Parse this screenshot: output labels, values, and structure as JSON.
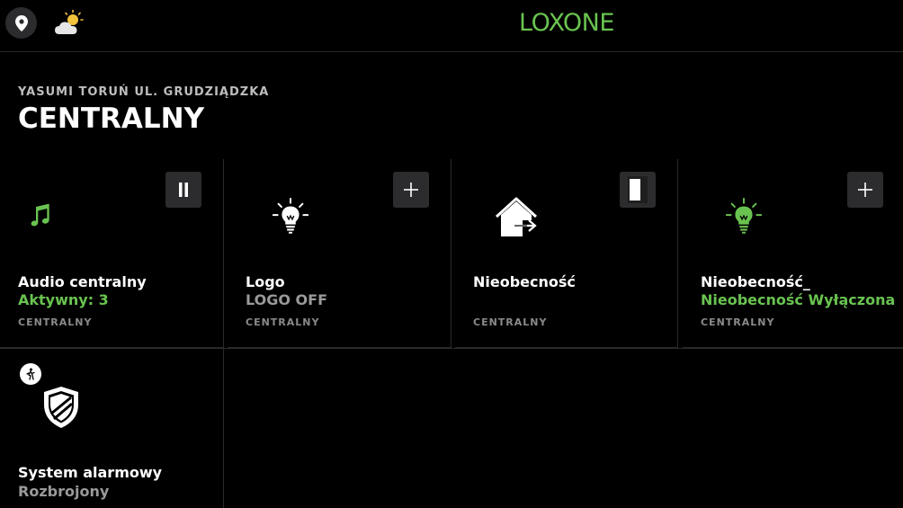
{
  "header": {
    "brand": "LOXONE",
    "location_icon": "location-pin-icon",
    "weather_icon": "partly-cloudy-icon"
  },
  "location": "YASUMI TORUŃ UL. GRUDZIĄDZKA",
  "room_title": "CENTRALNY",
  "colors": {
    "accent": "#69c350",
    "background": "#000000",
    "tile_button": "#2c2c2e",
    "muted": "#8a8a8a"
  },
  "tiles": [
    {
      "name": "Audio centralny",
      "state": "Aktywny: 3",
      "state_color": "#69c350",
      "room": "CENTRALNY",
      "icon": "music-note-icon",
      "action_icon": "pause-icon"
    },
    {
      "name": "Logo",
      "state": "LOGO OFF",
      "state_color": "#9a9a9a",
      "room": "CENTRALNY",
      "icon": "light-bulb-icon",
      "action_icon": "plus-icon"
    },
    {
      "name": "Nieobecność",
      "state": "",
      "state_color": "#9a9a9a",
      "room": "CENTRALNY",
      "icon": "house-leave-icon",
      "action_icon": "switch-toggle-icon"
    },
    {
      "name": "Nieobecność_",
      "state": "Nieobecność Wyłączona",
      "state_color": "#69c350",
      "room": "CENTRALNY",
      "icon": "light-bulb-icon",
      "action_icon": "plus-icon"
    },
    {
      "name": "System alarmowy",
      "state": "Rozbrojony",
      "state_color": "#9a9a9a",
      "room": "",
      "icon": "shield-icon",
      "badge_icon": "motion-sensor-icon"
    }
  ]
}
